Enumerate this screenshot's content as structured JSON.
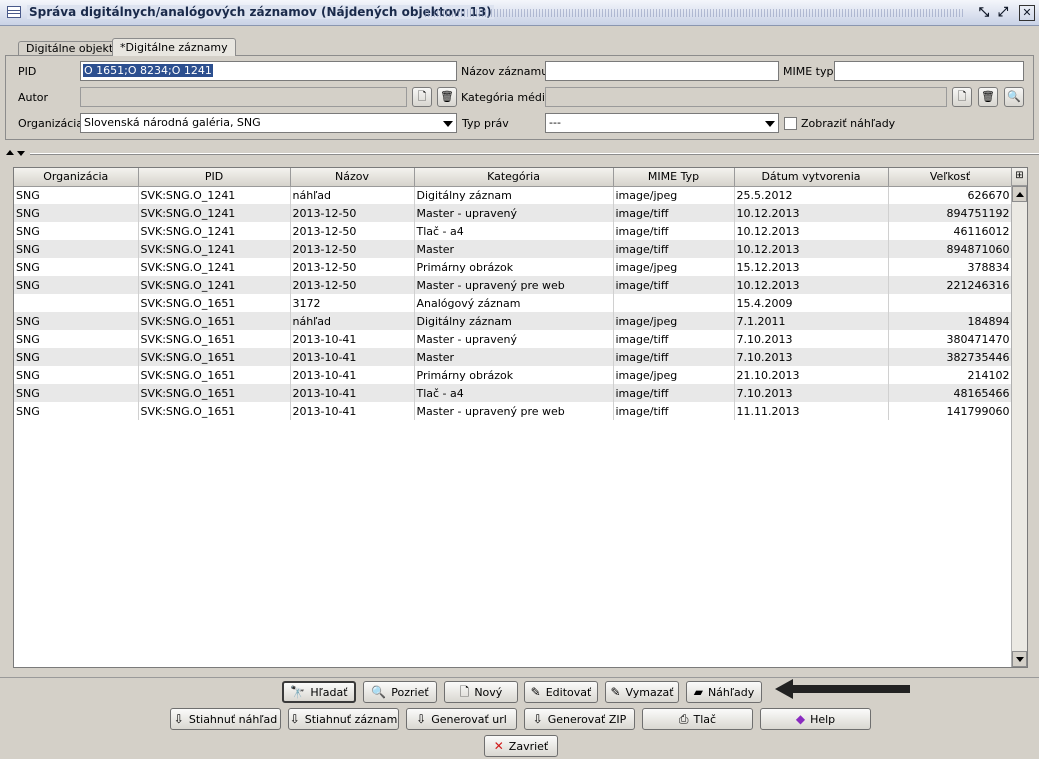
{
  "window": {
    "title": "Správa digitálnych/analógových záznamov (Nájdených objektov: 13)",
    "minimize_glyph": "⤡",
    "maximize_glyph": "⤢",
    "close_glyph": "✕"
  },
  "tabs": [
    {
      "label": "Digitálne objekty",
      "active": false
    },
    {
      "label": "*Digitálne záznamy",
      "active": true
    }
  ],
  "form": {
    "pid_label": "PID",
    "pid_value": "O 1651;O 8234;O 1241",
    "nazov_label": "Názov záznamu",
    "nazov_value": "",
    "mime_label": "MIME typ",
    "mime_value": "",
    "autor_label": "Autor",
    "autor_value": "",
    "kategoria_label": "Kategória média",
    "kategoria_value": "",
    "organizacia_label": "Organizácia",
    "organizacia_value": "Slovenská národná galéria, SNG",
    "typ_prav_label": "Typ práv",
    "typ_prav_value": "---",
    "nahlady_label": "Zobraziť náhľady"
  },
  "table": {
    "columns": [
      "Organizácia",
      "PID",
      "Názov",
      "Kategória",
      "MIME Typ",
      "Dátum vytvorenia",
      "Veľkosť"
    ],
    "rows": [
      [
        "SNG",
        "SVK:SNG.O_1241",
        "náhľad",
        "Digitálny záznam",
        "image/jpeg",
        "25.5.2012",
        "626670"
      ],
      [
        "SNG",
        "SVK:SNG.O_1241",
        "2013-12-50",
        "Master - upravený",
        "image/tiff",
        "10.12.2013",
        "894751192"
      ],
      [
        "SNG",
        "SVK:SNG.O_1241",
        "2013-12-50",
        "Tlač - a4",
        "image/tiff",
        "10.12.2013",
        "46116012"
      ],
      [
        "SNG",
        "SVK:SNG.O_1241",
        "2013-12-50",
        "Master",
        "image/tiff",
        "10.12.2013",
        "894871060"
      ],
      [
        "SNG",
        "SVK:SNG.O_1241",
        "2013-12-50",
        "Primárny obrázok",
        "image/jpeg",
        "15.12.2013",
        "378834"
      ],
      [
        "SNG",
        "SVK:SNG.O_1241",
        "2013-12-50",
        "Master - upravený pre web",
        "image/tiff",
        "10.12.2013",
        "221246316"
      ],
      [
        "",
        "SVK:SNG.O_1651",
        "3172",
        "Analógový záznam",
        "",
        "15.4.2009",
        ""
      ],
      [
        "SNG",
        "SVK:SNG.O_1651",
        "náhľad",
        "Digitálny záznam",
        "image/jpeg",
        "7.1.2011",
        "184894"
      ],
      [
        "SNG",
        "SVK:SNG.O_1651",
        "2013-10-41",
        "Master - upravený",
        "image/tiff",
        "7.10.2013",
        "380471470"
      ],
      [
        "SNG",
        "SVK:SNG.O_1651",
        "2013-10-41",
        "Master",
        "image/tiff",
        "7.10.2013",
        "382735446"
      ],
      [
        "SNG",
        "SVK:SNG.O_1651",
        "2013-10-41",
        "Primárny obrázok",
        "image/jpeg",
        "21.10.2013",
        "214102"
      ],
      [
        "SNG",
        "SVK:SNG.O_1651",
        "2013-10-41",
        "Tlač - a4",
        "image/tiff",
        "7.10.2013",
        "48165466"
      ],
      [
        "SNG",
        "SVK:SNG.O_1651",
        "2013-10-41",
        "Master - upravený pre web",
        "image/tiff",
        "11.11.2013",
        "141799060"
      ]
    ]
  },
  "buttons": {
    "hladat": "Hľadať",
    "pozriet": "Pozrieť",
    "novy": "Nový",
    "editovat": "Editovať",
    "vymazat": "Vymazať",
    "nahlady": "Náhľady",
    "stiahnut_nahlad": "Stiahnuť náhľad",
    "stiahnut_zaznam": "Stiahnuť záznam",
    "generovat_url": "Generovať url",
    "generovat_zip": "Generovať ZIP",
    "tlac": "Tlač",
    "help": "Help",
    "zavriet": "Zavrieť"
  },
  "icons": {
    "hladat": "binoculars-icon",
    "pozriet": "magnifier-icon",
    "novy": "new-document-icon",
    "editovat": "edit-icon",
    "vymazat": "delete-icon",
    "nahlady": "previews-icon",
    "download": "download-icon",
    "print": "printer-icon",
    "help": "book-icon",
    "close": "red-x-icon"
  }
}
